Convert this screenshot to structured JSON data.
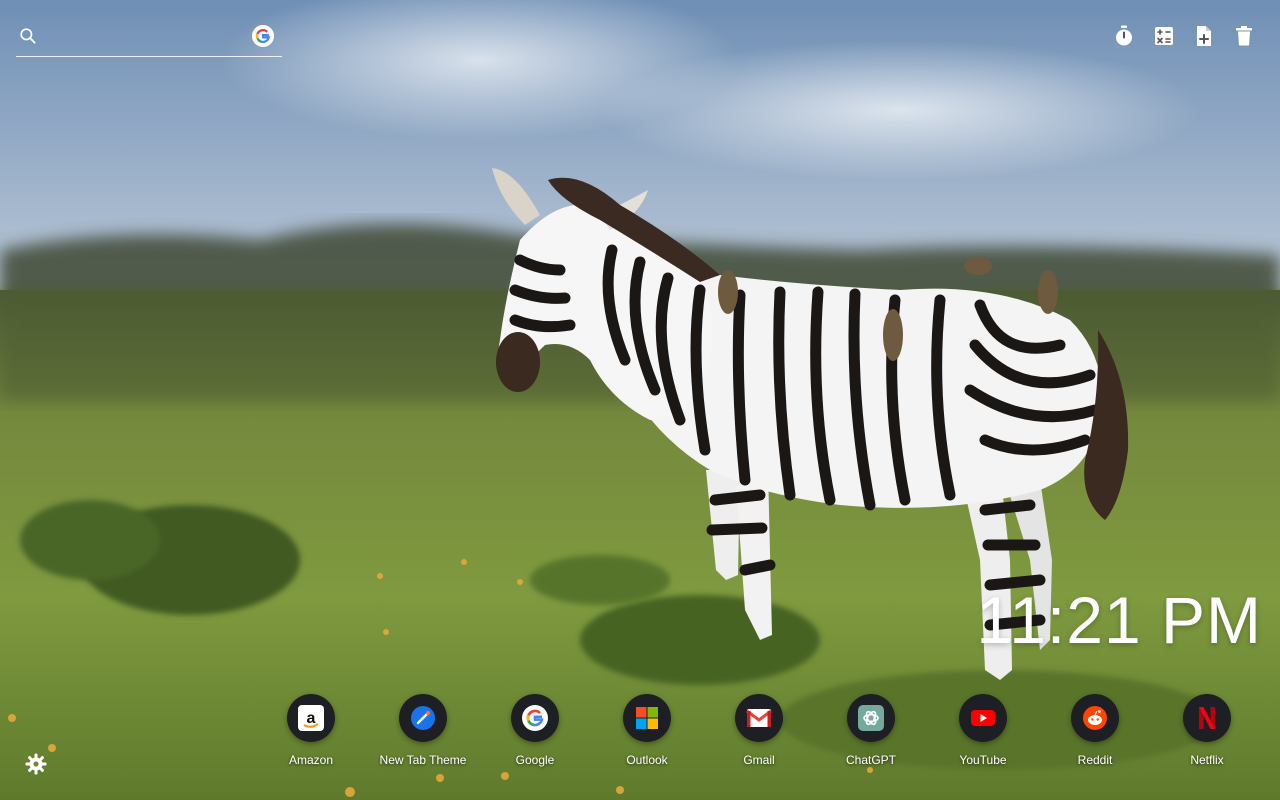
{
  "search": {
    "placeholder": ""
  },
  "toolbar": {
    "tools": [
      {
        "icon": "stopwatch-icon"
      },
      {
        "icon": "calculator-icon"
      },
      {
        "icon": "add-document-icon"
      },
      {
        "icon": "trash-icon"
      }
    ]
  },
  "clock": {
    "time": "11:21 PM"
  },
  "shortcuts": [
    {
      "label": "Amazon",
      "icon": "amazon-icon"
    },
    {
      "label": "New Tab Theme",
      "icon": "new-tab-theme-icon"
    },
    {
      "label": "Google",
      "icon": "google-icon"
    },
    {
      "label": "Outlook",
      "icon": "outlook-icon"
    },
    {
      "label": "Gmail",
      "icon": "gmail-icon"
    },
    {
      "label": "ChatGPT",
      "icon": "chatgpt-icon"
    },
    {
      "label": "YouTube",
      "icon": "youtube-icon"
    },
    {
      "label": "Reddit",
      "icon": "reddit-icon"
    },
    {
      "label": "Netflix",
      "icon": "netflix-icon"
    }
  ],
  "colors": {
    "dock_circle": "#1d1f24",
    "youtube_red": "#ff0000",
    "reddit_orange": "#ff4500",
    "netflix_red": "#e50914",
    "google_blue": "#4285f4"
  }
}
